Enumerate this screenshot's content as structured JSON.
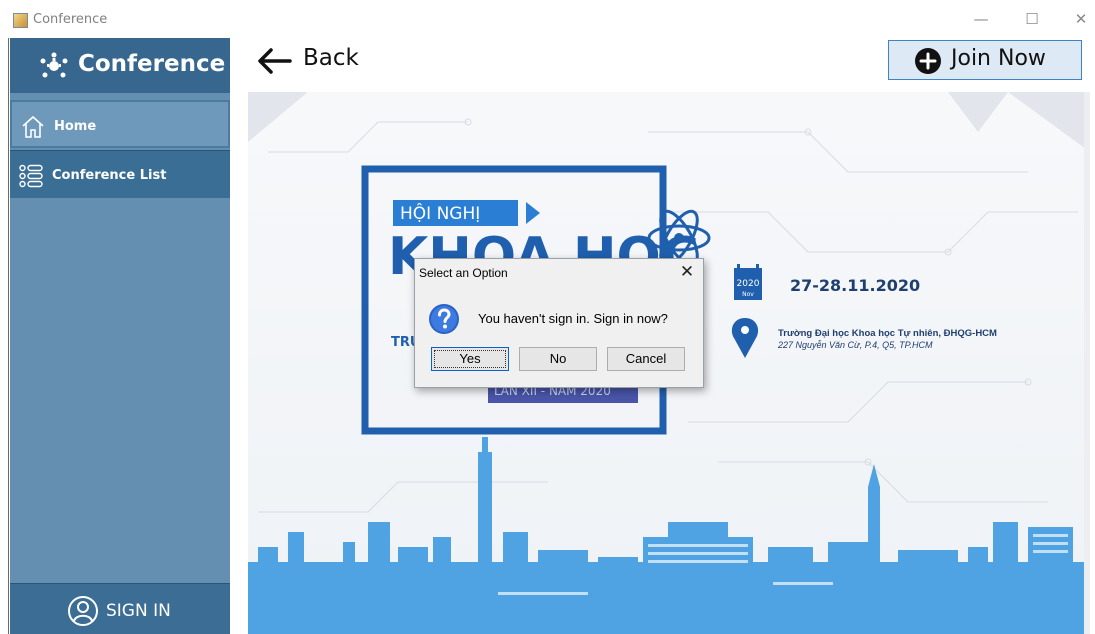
{
  "window": {
    "title": "Conference",
    "minimize_glyph": "—",
    "maximize_glyph": "☐",
    "close_glyph": "✕"
  },
  "sidebar": {
    "brand": {
      "icon": "conference-icon",
      "label": "Conference"
    },
    "items": [
      {
        "icon": "home-icon",
        "label": "Home"
      },
      {
        "icon": "list-icon",
        "label": "Conference List"
      }
    ],
    "signin": {
      "icon": "user-circle-icon",
      "label": "SIGN IN"
    }
  },
  "header": {
    "back": {
      "icon": "arrow-left-icon",
      "label": "Back"
    },
    "join": {
      "icon": "plus-circle-icon",
      "label": "Join Now"
    }
  },
  "banner": {
    "tag": "HỘI NGHỊ",
    "headline": "KHOA HỌC",
    "subline": "TRƯ",
    "edition": "LẦN XII - NĂM 2020",
    "calendar_year": "2020",
    "calendar_month": "Nov",
    "date": "27-28.11.2020",
    "venue": "Trường Đại học Khoa học Tự nhiên, ĐHQG-HCM",
    "address": "227 Nguyễn Văn Cừ, P.4, Q5, TP.HCM",
    "colors": {
      "primary": "#1f5fae",
      "accent": "#2a7fd4",
      "skyline": "#4fa3e3"
    }
  },
  "dialog": {
    "title": "Select an Option",
    "message": "You haven't sign in. Sign in now?",
    "icon": "question-icon",
    "buttons": {
      "yes": "Yes",
      "no": "No",
      "cancel": "Cancel"
    },
    "close_glyph": "✕"
  },
  "colors": {
    "sidebar": "#658fb0",
    "sidebar_dark": "#37678e",
    "join_bg": "#dde9f4",
    "join_border": "#3a84c9"
  }
}
